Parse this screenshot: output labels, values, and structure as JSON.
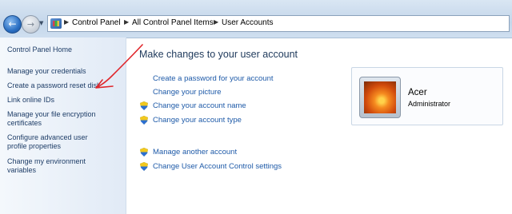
{
  "breadcrumb": [
    "Control Panel",
    "All Control Panel Items",
    "User Accounts"
  ],
  "sidebar": {
    "home": "Control Panel Home",
    "items": [
      {
        "lines": [
          "Manage your credentials"
        ]
      },
      {
        "lines": [
          "Create a password reset disk"
        ]
      },
      {
        "lines": [
          "Link online IDs"
        ]
      },
      {
        "lines": [
          "Manage your file encryption",
          "certificates"
        ]
      },
      {
        "lines": [
          "Configure advanced user",
          "profile properties"
        ]
      },
      {
        "lines": [
          "Change my environment",
          "variables"
        ]
      }
    ]
  },
  "main": {
    "title": "Make changes to your user account",
    "tasks": [
      {
        "label": "Create a password for your account",
        "shield": false
      },
      {
        "label": "Change your picture",
        "shield": false
      },
      {
        "label": "Change your account name",
        "shield": true
      },
      {
        "label": "Change your account type",
        "shield": true
      }
    ],
    "other_tasks": [
      {
        "label": "Manage another account",
        "shield": true
      },
      {
        "label": "Change User Account Control settings",
        "shield": true
      }
    ]
  },
  "account": {
    "name": "Acer",
    "role": "Administrator"
  },
  "colors": {
    "link": "#1e5aa8",
    "sidebar_link": "#1e3d67",
    "annotation": "#e0262b"
  }
}
